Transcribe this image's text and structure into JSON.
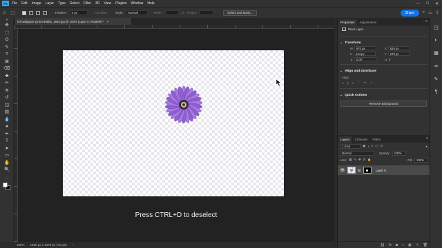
{
  "menubar": {
    "logo": "Ps",
    "items": [
      "File",
      "Edit",
      "Image",
      "Layer",
      "Type",
      "Select",
      "Filter",
      "3D",
      "View",
      "Plugins",
      "Window",
      "Help"
    ],
    "window_controls": [
      "—",
      "□",
      "✕"
    ]
  },
  "options": {
    "feather_label": "Feather:",
    "feather_value": "0 px",
    "antialias_label": "Anti-alias",
    "style_label": "Style:",
    "style_value": "Normal",
    "width_label": "Width:",
    "height_label": "Height:",
    "select_mask": "Select and Mask...",
    "share": "Share",
    "icons": [
      "search-icon",
      "workspace-icon",
      "share-settings-icon"
    ]
  },
  "document": {
    "tab_title": "hd-wallpaper-g7be7488bb_1920.jpg @ 100% (Layer 0, RGB/8#) *",
    "tab_close": "×"
  },
  "tools": {
    "icons": [
      "move-icon",
      "marquee-icon",
      "lasso-icon",
      "quick-select-icon",
      "crop-icon",
      "frame-icon",
      "eyedropper-icon",
      "healing-icon",
      "brush-icon",
      "stamp-icon",
      "history-brush-icon",
      "eraser-icon",
      "gradient-icon",
      "blur-icon",
      "dodge-icon",
      "pen-icon",
      "type-icon",
      "path-select-icon",
      "rectangle-icon",
      "hand-icon",
      "zoom-icon",
      "more-tools-icon"
    ],
    "glyphs": [
      "✥",
      "⬚",
      "ʘ",
      "✎",
      "⌗",
      "⊠",
      "⌫",
      "✚",
      "✏",
      "⎈",
      "↺",
      "◫",
      "▤",
      "💧",
      "●",
      "✒",
      "T",
      "➤",
      "▭",
      "✋",
      "🔍",
      "…"
    ],
    "fg_color": "#ffffff",
    "bg_color": "#000000"
  },
  "canvas": {
    "caption": "Press CTRL+D to deselect"
  },
  "status": {
    "zoom": "100%",
    "doc_size": "1920 px x 1278 px (72 ppi)",
    "arrow": "›"
  },
  "properties": {
    "tabs": [
      "Properties",
      "Adjustments"
    ],
    "menu": "≡",
    "layer_type": "Pixel Layer",
    "transform_title": "Transform",
    "w_label": "W",
    "w_value": "670 px",
    "h_label": "H",
    "h_value": "444 px",
    "x_label": "X",
    "x_value": "625 px",
    "y_label": "Y",
    "y_value": "279 px",
    "angle_value": "0.00°",
    "align_title": "Align and Distribute",
    "align_label": "Align:",
    "quick_actions_title": "Quick Actions",
    "remove_bg": "Remove Background",
    "more": "···"
  },
  "layers": {
    "tabs": [
      "Layers",
      "Channels",
      "Paths"
    ],
    "kind_label": "Kind",
    "blend_mode": "Normal",
    "opacity_label": "Opacity:",
    "opacity_value": "100%",
    "lock_label": "Lock:",
    "fill_label": "Fill:",
    "fill_value": "100%",
    "layer_name": "Layer 0",
    "bottom_icons": [
      "link-icon",
      "fx-icon",
      "mask-icon",
      "adjustment-icon",
      "group-icon",
      "new-layer-icon",
      "trash-icon"
    ],
    "bottom_glyphs": [
      "⛓",
      "fx",
      "◙",
      "◑",
      "▣",
      "＋",
      "🗑"
    ]
  },
  "right_icons": [
    "history-icon",
    "color-icon",
    "swatches-icon",
    "libraries-icon",
    "brush-settings-icon",
    "paragraph-icon"
  ],
  "right_glyphs": [
    "◳",
    "◐",
    "▦",
    "♒",
    "✎",
    "¶"
  ]
}
